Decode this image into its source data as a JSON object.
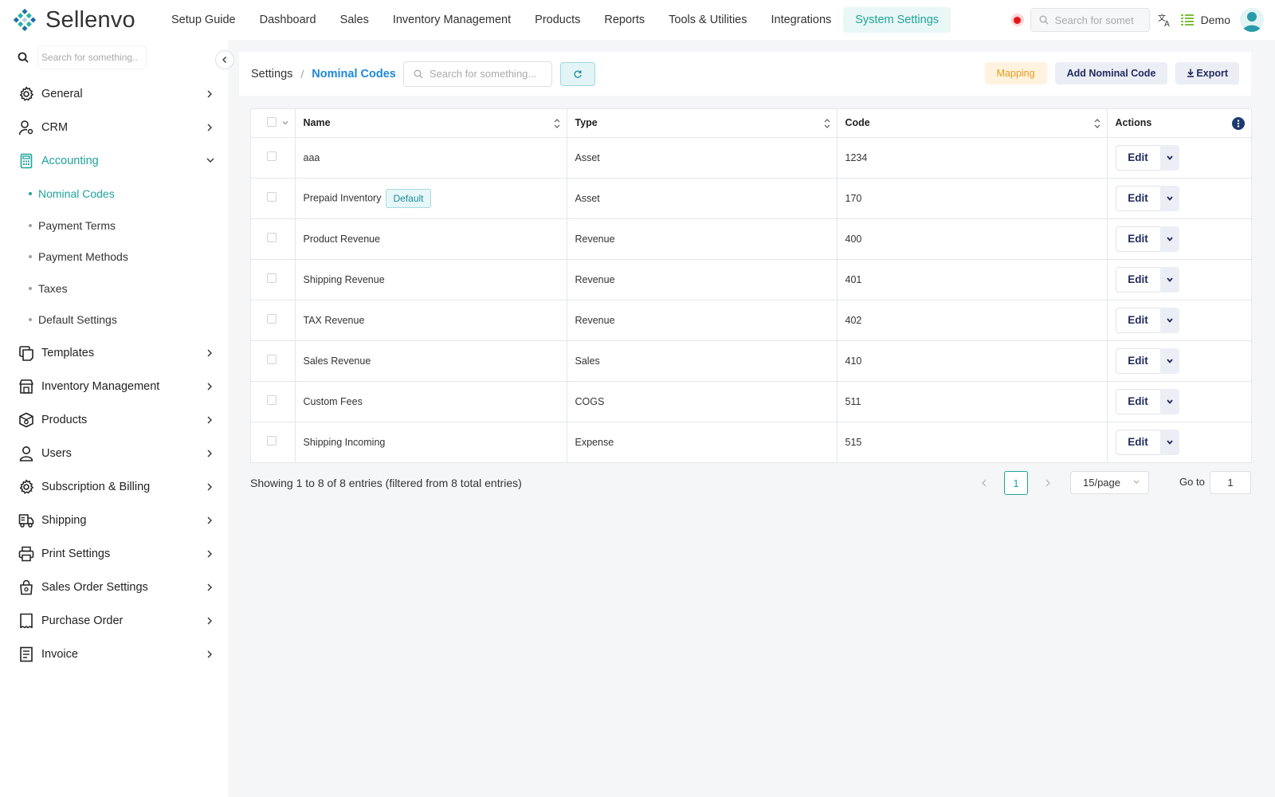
{
  "app": {
    "name": "Sellenvo"
  },
  "topnav": {
    "items": [
      {
        "label": "Setup Guide"
      },
      {
        "label": "Dashboard"
      },
      {
        "label": "Sales"
      },
      {
        "label": "Inventory Management"
      },
      {
        "label": "Products"
      },
      {
        "label": "Reports"
      },
      {
        "label": "Tools & Utilities"
      },
      {
        "label": "Integrations"
      },
      {
        "label": "System Settings",
        "active": true
      }
    ],
    "search_placeholder": "Search for somet",
    "user_name": "Demo"
  },
  "sidebar": {
    "search_placeholder": "Search for something..",
    "items": [
      {
        "label": "General",
        "icon": "gear-icon"
      },
      {
        "label": "CRM",
        "icon": "user-gear-icon"
      },
      {
        "label": "Accounting",
        "icon": "calculator-icon",
        "active": true,
        "expanded": true
      },
      {
        "label": "Templates",
        "icon": "templates-icon"
      },
      {
        "label": "Inventory Management",
        "icon": "store-icon"
      },
      {
        "label": "Products",
        "icon": "box-gear-icon"
      },
      {
        "label": "Users",
        "icon": "user-icon"
      },
      {
        "label": "Subscription & Billing",
        "icon": "gear-icon"
      },
      {
        "label": "Shipping",
        "icon": "truck-icon"
      },
      {
        "label": "Print Settings",
        "icon": "printer-icon"
      },
      {
        "label": "Sales Order Settings",
        "icon": "bag-icon"
      },
      {
        "label": "Purchase Order",
        "icon": "receipt-icon"
      },
      {
        "label": "Invoice",
        "icon": "invoice-icon"
      }
    ],
    "accounting_sub": [
      {
        "label": "Nominal Codes",
        "active": true
      },
      {
        "label": "Payment Terms"
      },
      {
        "label": "Payment Methods"
      },
      {
        "label": "Taxes"
      },
      {
        "label": "Default Settings"
      }
    ]
  },
  "header": {
    "breadcrumb_root": "Settings",
    "breadcrumb_sep": "/",
    "breadcrumb_current": "Nominal Codes",
    "search_placeholder": "Search for something...",
    "mapping_label": "Mapping",
    "add_label": "Add Nominal Code",
    "export_label": "Export"
  },
  "table": {
    "columns": [
      "Name",
      "Type",
      "Code",
      "Actions"
    ],
    "rows": [
      {
        "name": "aaa",
        "badge": "",
        "type": "Asset",
        "code": "1234",
        "action": "Edit"
      },
      {
        "name": "Prepaid Inventory",
        "badge": "Default",
        "type": "Asset",
        "code": "170",
        "action": "Edit"
      },
      {
        "name": "Product Revenue",
        "badge": "",
        "type": "Revenue",
        "code": "400",
        "action": "Edit"
      },
      {
        "name": "Shipping Revenue",
        "badge": "",
        "type": "Revenue",
        "code": "401",
        "action": "Edit"
      },
      {
        "name": "TAX Revenue",
        "badge": "",
        "type": "Revenue",
        "code": "402",
        "action": "Edit"
      },
      {
        "name": "Sales Revenue",
        "badge": "",
        "type": "Sales",
        "code": "410",
        "action": "Edit"
      },
      {
        "name": "Custom Fees",
        "badge": "",
        "type": "COGS",
        "code": "511",
        "action": "Edit"
      },
      {
        "name": "Shipping Incoming",
        "badge": "",
        "type": "Expense",
        "code": "515",
        "action": "Edit"
      }
    ]
  },
  "footer": {
    "summary": "Showing 1 to 8 of 8 entries (filtered from 8 total entries)",
    "current_page": "1",
    "per_page": "15/page",
    "goto_label": "Go to",
    "goto_value": "1"
  },
  "colors": {
    "accent": "#1fa39a",
    "link": "#1e88d9",
    "navy": "#1f2a5c",
    "mapping": "#e89a19"
  }
}
